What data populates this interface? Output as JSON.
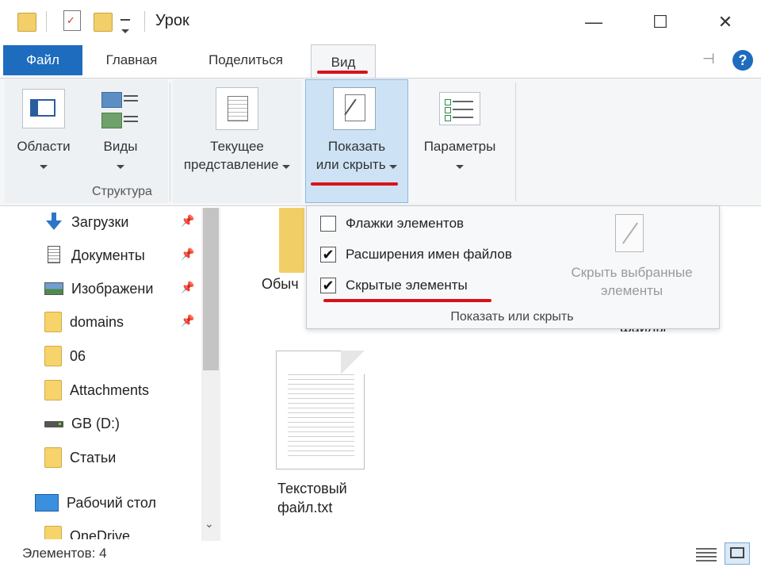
{
  "window": {
    "title": "Урок",
    "controls": {
      "minimize": "—",
      "maximize": "☐",
      "close": "✕"
    }
  },
  "tabs": {
    "file": "Файл",
    "home": "Главная",
    "share": "Поделиться",
    "view": "Вид"
  },
  "ribbon": {
    "panes": "Области",
    "layouts": "Виды",
    "structure_group": "Структура",
    "current_view": [
      "Текущее",
      "представление"
    ],
    "show_hide": [
      "Показать",
      "или скрыть"
    ],
    "options": "Параметры"
  },
  "dropdown": {
    "items": [
      {
        "label": "Флажки элементов",
        "checked": false
      },
      {
        "label": "Расширения имен файлов",
        "checked": true
      },
      {
        "label": "Скрытые элементы",
        "checked": true
      }
    ],
    "hide_selected": [
      "Скрыть выбранные",
      "элементы"
    ],
    "group_label": "Показать или скрыть"
  },
  "nav": {
    "items": [
      {
        "label": "Загрузки",
        "icon": "download-icon"
      },
      {
        "label": "Документы",
        "icon": "documents-icon"
      },
      {
        "label": "Изображени",
        "icon": "pictures-icon"
      },
      {
        "label": "domains",
        "icon": "folder-icon"
      },
      {
        "label": "06",
        "icon": "folder-icon"
      },
      {
        "label": "Attachments",
        "icon": "folder-icon"
      },
      {
        "label": "GB (D:)",
        "icon": "drive-icon"
      },
      {
        "label": "Статьи",
        "icon": "folder-icon"
      },
      {
        "label": "Рабочий стол",
        "icon": "desktop-icon"
      },
      {
        "label": "OneDrive",
        "icon": "folder-icon"
      }
    ],
    "pin_glyph": "📌"
  },
  "files": {
    "partial_folder_label": "Обыч",
    "partial_right_label": "файлы",
    "text_file": [
      "Текстовый",
      "файл.txt"
    ]
  },
  "status": {
    "count": "Элементов: 4"
  },
  "colors": {
    "file_tab": "#1e6cbd",
    "highlight": "#cde3f5",
    "underline": "#d8121a"
  }
}
